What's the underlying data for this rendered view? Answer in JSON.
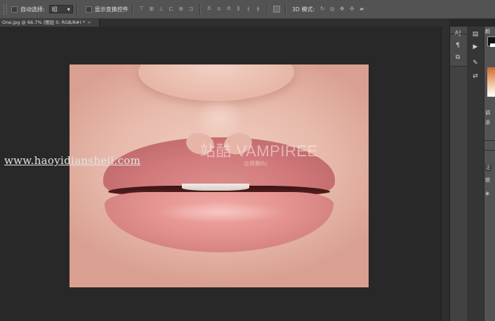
{
  "options_bar": {
    "auto_select_label": "自动选择:",
    "auto_select_value": "组",
    "show_transform_label": "显示变换控件",
    "mode_3d_label": "3D 模式:"
  },
  "document_tab": {
    "title": "One.jpg @ 66.7% (图层 0, RGB/8#) *",
    "close": "×"
  },
  "canvas": {
    "watermark_main": "站酷 VAMPIREE",
    "watermark_sub": "@周鹏Rc",
    "site_url": "www.haoyidiansheji.com"
  },
  "right_panel": {
    "tab_top": "颜",
    "tab_swatch_label": "调",
    "tab_add": "添",
    "tab_layer_mode": "正",
    "tab_opacity": "锁"
  },
  "colors": {
    "app_bg": "#282828",
    "options_bar": "#535353",
    "accent_swatch_fg": "#111111"
  }
}
